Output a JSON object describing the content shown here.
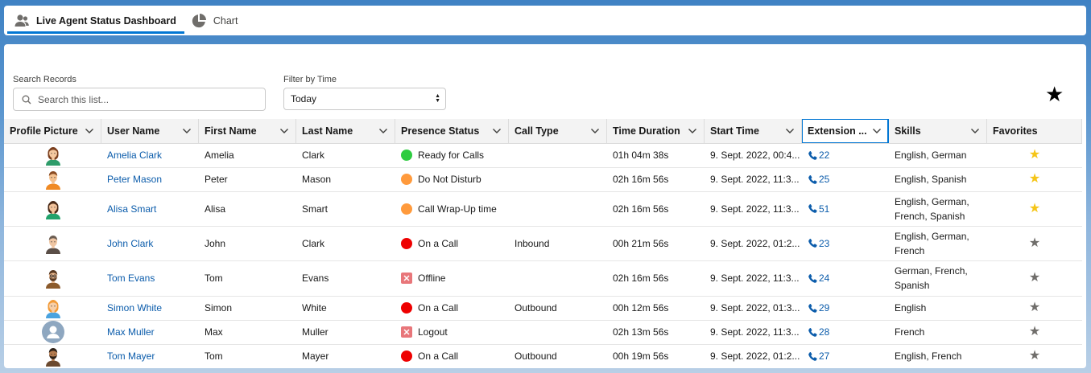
{
  "tabs": [
    {
      "label": "Live Agent Status Dashboard",
      "icon": "users-icon",
      "active": true
    },
    {
      "label": "Chart",
      "icon": "pie-chart-icon",
      "active": false
    }
  ],
  "filters": {
    "search_label": "Search Records",
    "search_placeholder": "Search this list...",
    "time_label": "Filter by Time",
    "time_value": "Today"
  },
  "columns": [
    "Profile Picture",
    "User Name",
    "First Name",
    "Last Name",
    "Presence Status",
    "Call Type",
    "Time Duration",
    "Start Time",
    "Extension ...",
    "Skills",
    "Favorites"
  ],
  "colors": {
    "green": "#2ecc40",
    "orange": "#ff9a3c",
    "red": "#ee0000",
    "gray_x": "#e8767a",
    "star_gold": "#f5c518",
    "star_gray": "#706e6b",
    "link": "#0b5cab"
  },
  "rows": [
    {
      "avatar": "woman-brown-hair",
      "user_name": "Amelia Clark",
      "first": "Amelia",
      "last": "Clark",
      "status": "Ready for Calls",
      "status_type": "green",
      "call_type": "",
      "duration": "01h 04m 38s",
      "start": "9. Sept. 2022, 00:4...",
      "ext": "22",
      "skills": "English, German",
      "favorite": true
    },
    {
      "avatar": "man-brown-hair",
      "user_name": "Peter Mason",
      "first": "Peter",
      "last": "Mason",
      "status": "Do Not Disturb",
      "status_type": "orange",
      "call_type": "",
      "duration": "02h 16m 56s",
      "start": "9. Sept. 2022, 11:3...",
      "ext": "25",
      "skills": "English, Spanish",
      "favorite": true
    },
    {
      "avatar": "woman-dark-hair",
      "user_name": "Alisa Smart",
      "first": "Alisa",
      "last": "Smart",
      "status": "Call Wrap-Up time",
      "status_type": "orange",
      "call_type": "",
      "duration": "02h 16m 56s",
      "start": "9. Sept. 2022, 11:3...",
      "ext": "51",
      "skills": "English, German, French, Spanish",
      "favorite": true
    },
    {
      "avatar": "man-suit",
      "user_name": "John Clark",
      "first": "John",
      "last": "Clark",
      "status": "On a Call",
      "status_type": "red",
      "call_type": "Inbound",
      "duration": "00h 21m 56s",
      "start": "9. Sept. 2022, 01:2...",
      "ext": "23",
      "skills": "English, German, French",
      "favorite": false
    },
    {
      "avatar": "man-beard-glasses",
      "user_name": "Tom Evans",
      "first": "Tom",
      "last": "Evans",
      "status": "Offline",
      "status_type": "x",
      "call_type": "",
      "duration": "02h 16m 56s",
      "start": "9. Sept. 2022, 11:3...",
      "ext": "24",
      "skills": "German, French, Spanish",
      "favorite": false
    },
    {
      "avatar": "woman-ginger",
      "user_name": "Simon White",
      "first": "Simon",
      "last": "White",
      "status": "On a Call",
      "status_type": "red",
      "call_type": "Outbound",
      "duration": "00h 12m 56s",
      "start": "9. Sept. 2022, 01:3...",
      "ext": "29",
      "skills": "English",
      "favorite": false
    },
    {
      "avatar": "default-user",
      "user_name": "Max Muller",
      "first": "Max",
      "last": "Muller",
      "status": "Logout",
      "status_type": "x",
      "call_type": "",
      "duration": "02h 13m 56s",
      "start": "9. Sept. 2022, 11:3...",
      "ext": "28",
      "skills": "French",
      "favorite": false
    },
    {
      "avatar": "man-dark-beard",
      "user_name": "Tom Mayer",
      "first": "Tom",
      "last": "Mayer",
      "status": "On a Call",
      "status_type": "red",
      "call_type": "Outbound",
      "duration": "00h 19m 56s",
      "start": "9. Sept. 2022, 01:2...",
      "ext": "27",
      "skills": "English, French",
      "favorite": false
    }
  ]
}
